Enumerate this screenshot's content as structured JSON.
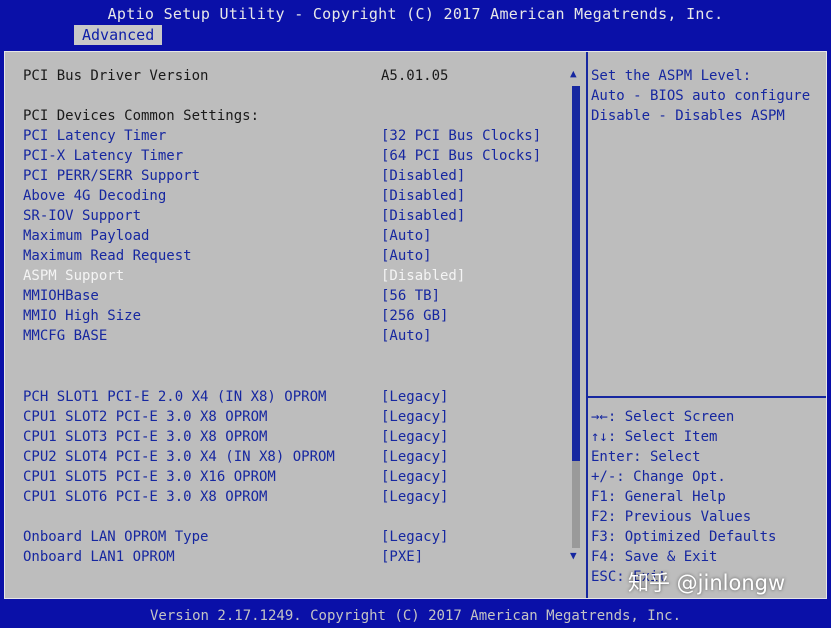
{
  "header": {
    "title": "Aptio Setup Utility - Copyright (C) 2017 American Megatrends, Inc.",
    "tab": "Advanced"
  },
  "settings": [
    {
      "label": "PCI Bus Driver Version",
      "value": "A5.01.05"
    },
    {
      "label": "PCI Devices Common Settings:",
      "value": ""
    },
    {
      "label": "PCI Latency Timer",
      "value": "[32 PCI Bus Clocks]"
    },
    {
      "label": "PCI-X Latency Timer",
      "value": "[64 PCI Bus Clocks]"
    },
    {
      "label": "PCI PERR/SERR Support",
      "value": "[Disabled]"
    },
    {
      "label": "Above 4G Decoding",
      "value": "[Disabled]"
    },
    {
      "label": "SR-IOV Support",
      "value": "[Disabled]"
    },
    {
      "label": "Maximum Payload",
      "value": "[Auto]"
    },
    {
      "label": "Maximum Read Request",
      "value": "[Auto]"
    },
    {
      "label": "ASPM Support",
      "value": "[Disabled]"
    },
    {
      "label": "MMIOHBase",
      "value": "[56 TB]"
    },
    {
      "label": "MMIO High Size",
      "value": "[256 GB]"
    },
    {
      "label": "MMCFG BASE",
      "value": "[Auto]"
    },
    {
      "label": "PCH SLOT1 PCI-E 2.0 X4 (IN X8) OPROM",
      "value": "[Legacy]"
    },
    {
      "label": "CPU1 SLOT2 PCI-E 3.0 X8 OPROM",
      "value": "[Legacy]"
    },
    {
      "label": "CPU1 SLOT3 PCI-E 3.0 X8 OPROM",
      "value": "[Legacy]"
    },
    {
      "label": "CPU2 SLOT4 PCI-E 3.0 X4 (IN X8) OPROM",
      "value": "[Legacy]"
    },
    {
      "label": "CPU1 SLOT5 PCI-E 3.0 X16 OPROM",
      "value": "[Legacy]"
    },
    {
      "label": "CPU1 SLOT6 PCI-E 3.0 X8 OPROM",
      "value": "[Legacy]"
    },
    {
      "label": "Onboard LAN OPROM Type",
      "value": "[Legacy]"
    },
    {
      "label": "Onboard LAN1 OPROM",
      "value": "[PXE]"
    }
  ],
  "scrollbar": {
    "up": "▲",
    "down": "▼"
  },
  "help": [
    "Set the ASPM Level:",
    "Auto - BIOS auto configure",
    "Disable - Disables ASPM"
  ],
  "keys": [
    "→←: Select Screen",
    "↑↓: Select Item",
    "Enter: Select",
    "+/-: Change Opt.",
    "F1: General Help",
    "F2: Previous Values",
    "F3: Optimized Defaults",
    "F4: Save & Exit",
    "ESC: Exit"
  ],
  "footer": "Version 2.17.1249. Copyright (C) 2017 American Megatrends, Inc.",
  "watermark": "知乎 @jinlongw",
  "colors": {
    "background": "#0a10a8",
    "panel": "#bdbdbd",
    "accent": "#1627a0",
    "selected_text": "#f4f4f4"
  }
}
